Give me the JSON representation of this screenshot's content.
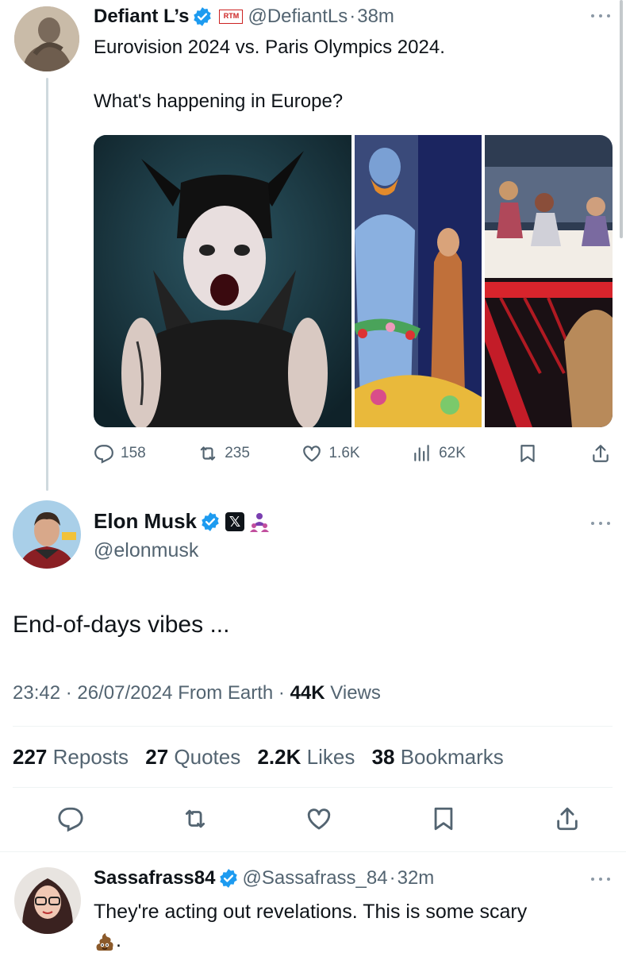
{
  "parent": {
    "display_name": "Defiant L’s",
    "affiliate_badge": "RTM",
    "handle": "@DefiantLs",
    "separator": "·",
    "time": "38m",
    "text_line1": "Eurovision 2024 vs. Paris Olympics 2024.",
    "text_line2": "What's happening in Europe?",
    "replies": "158",
    "reposts": "235",
    "likes": "1.6K",
    "views": "62K"
  },
  "main": {
    "display_name": "Elon Musk",
    "x_badge": "𝕏",
    "handle": "@elonmusk",
    "text": "End-of-days vibes ...",
    "time": "23:42",
    "date": "26/07/2024",
    "location": "From Earth",
    "views_count": "44K",
    "views_label": "Views",
    "separator": "·",
    "reposts_count": "227",
    "reposts_label": "Reposts",
    "quotes_count": "27",
    "quotes_label": "Quotes",
    "likes_count": "2.2K",
    "likes_label": "Likes",
    "bookmarks_count": "38",
    "bookmarks_label": "Bookmarks"
  },
  "reply": {
    "display_name": "Sassafrass84",
    "handle": "@Sassafrass_84",
    "separator": "·",
    "time": "32m",
    "text": "They're acting out revelations. This is some scary",
    "text_end": "."
  },
  "icons": {
    "verified": "verified-badge-icon",
    "reply": "reply-icon",
    "repost": "repost-icon",
    "like": "heart-icon",
    "views": "views-icon",
    "bookmark": "bookmark-icon",
    "share": "share-icon",
    "more": "more-icon"
  },
  "colors": {
    "verified_blue": "#1d9bf0",
    "text": "#0f1419",
    "muted": "#536471"
  }
}
